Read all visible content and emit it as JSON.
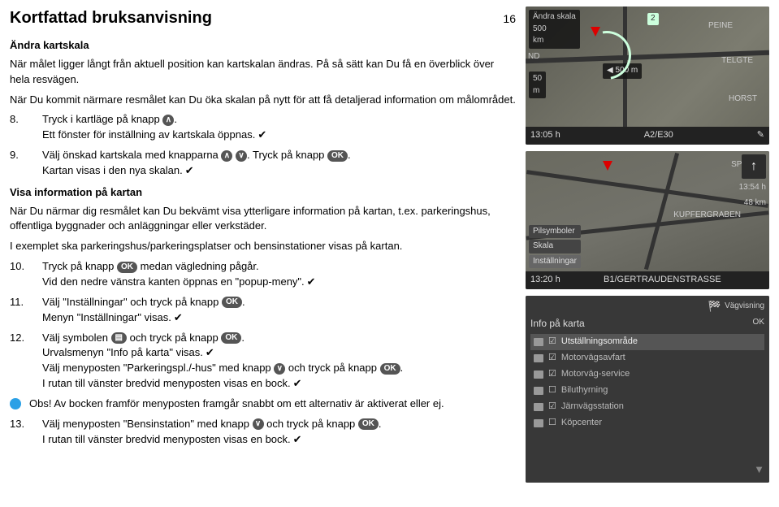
{
  "page_number": "16",
  "title": "Kortfattad bruksanvisning",
  "section1": {
    "heading": "Ändra kartskala",
    "intro1": "När målet ligger långt från aktuell position kan kartskalan ändras. På så sätt kan Du få en överblick över hela resvägen.",
    "intro2": "När Du kommit närmare resmålet kan Du öka skalan på nytt för att få detaljerad information om målområdet.",
    "step8_pre": "Tryck i kartläge på knapp ",
    "step8_after": ".",
    "step8_line2_pre": "Ett fönster för inställning av kartskala öppnas.",
    "step9_pre": "Välj önskad kartskala med knapparna ",
    "step9_mid": ". Tryck på knapp ",
    "step9_after": ".",
    "step9_line2": "Kartan visas i den nya skalan.",
    "num8": "8.",
    "num9": "9."
  },
  "keys": {
    "up": "∧",
    "down": "∨",
    "ok": "OK"
  },
  "section2": {
    "heading": "Visa information på kartan",
    "p1": "När Du närmar dig resmålet kan Du bekvämt visa ytterligare information på kartan, t.ex. parkeringshus, offentliga byggnader och anläggningar eller verkstäder.",
    "p2": "I exemplet ska parkeringshus/parkeringsplatser och bensinstationer visas på kartan.",
    "num10": "10.",
    "step10_l1_pre": "Tryck på knapp ",
    "step10_l1_post": " medan vägledning pågår.",
    "step10_l2": "Vid den nedre vänstra kanten öppnas en \"popup-meny\".",
    "num11": "11.",
    "step11_l1_pre": "Välj \"Inställningar\" och tryck på knapp ",
    "step11_l1_post": ".",
    "step11_l2": "Menyn \"Inställningar\" visas.",
    "num12": "12.",
    "step12_l1_pre": "Välj symbolen ",
    "step12_l1_mid": " och tryck på knapp ",
    "step12_l1_post": ".",
    "step12_l2": "Urvalsmenyn \"Info på karta\" visas.",
    "step12_l3_pre": "Välj menyposten \"Parkeringspl./-hus\" med knapp ",
    "step12_l3_mid": " och tryck på knapp ",
    "step12_l3_post": ".",
    "step12_l4": "I rutan till vänster bredvid menyposten visas en bock.",
    "obs": "Obs! Av bocken framför menyposten framgår snabbt om ett alternativ är aktiverat eller ej.",
    "num13": "13.",
    "step13_l1_pre": "Välj menyposten \"Bensinstation\" med knapp ",
    "step13_l1_mid": " och tryck på knapp ",
    "step13_l1_post": ".",
    "step13_l2": "I rutan till vänster bredvid menyposten visas en bock."
  },
  "map1": {
    "scale_label": "Ändra skala",
    "scale_val1": "500",
    "scale_unit1": "km",
    "scale_val2": "50",
    "scale_unit2": "m",
    "dist": "500 m",
    "city1": "PEINE",
    "city2": "TELGTE",
    "city3": "HORST",
    "badge": "2",
    "side_label": "ND",
    "time": "13:05 h",
    "route": "A2/E30"
  },
  "map2": {
    "label1": "SPREE",
    "label2": "KUPFERGRABEN",
    "popup1": "Pilsymboler",
    "popup2": "Skala",
    "popup3": "Inställningar",
    "time": "13:20 h",
    "route": "B1/GERTRAUDENSTRASSE",
    "right_time": "13:54 h",
    "right_dist": "48 km"
  },
  "map3": {
    "header": "Vägvisning",
    "title": "Info på karta",
    "ok": "OK",
    "items": [
      "Utställningsområde",
      "Motorvägsavfart",
      "Motorväg-service",
      "Biluthyrning",
      "Järnvägsstation",
      "Köpcenter"
    ]
  }
}
